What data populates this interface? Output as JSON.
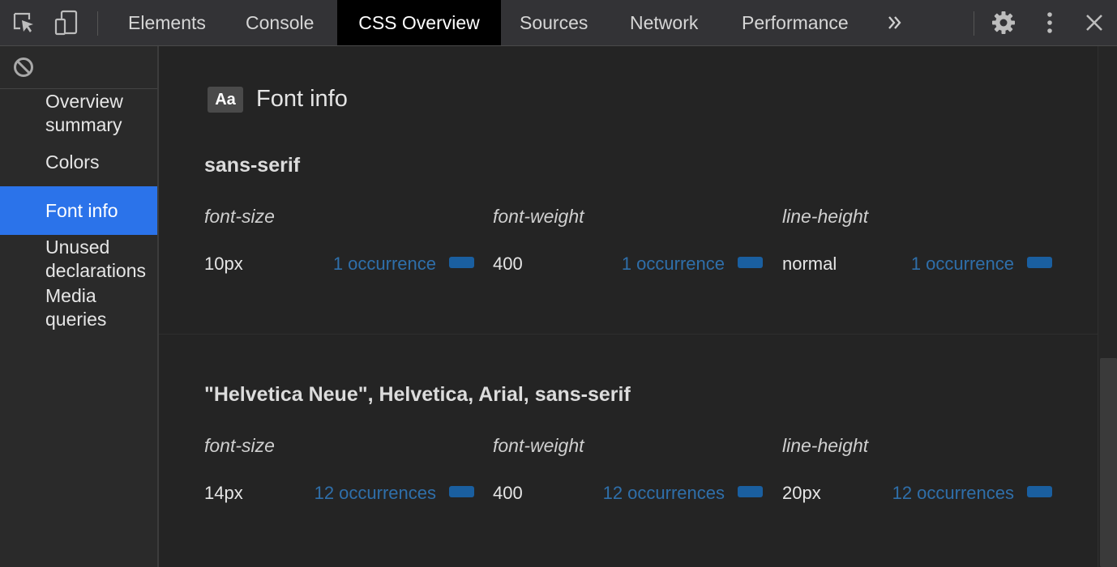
{
  "toolbar": {
    "tabs": [
      {
        "label": "Elements"
      },
      {
        "label": "Console"
      },
      {
        "label": "CSS Overview",
        "active": true
      },
      {
        "label": "Sources"
      },
      {
        "label": "Network"
      },
      {
        "label": "Performance"
      }
    ],
    "icons": [
      "inspect-element-icon",
      "device-toggle-icon",
      "more-tabs-icon",
      "settings-icon",
      "more-options-icon",
      "close-icon"
    ]
  },
  "sidebar": {
    "clear_icon": "clear-icon",
    "items": [
      {
        "label": "Overview summary"
      },
      {
        "label": "Colors"
      },
      {
        "label": "Font info",
        "selected": true
      },
      {
        "label": "Unused declarations"
      },
      {
        "label": "Media queries"
      }
    ]
  },
  "main": {
    "section_badge": "Aa",
    "section_title": "Font info",
    "font_groups": [
      {
        "family": "sans-serif",
        "columns": [
          {
            "property": "font-size",
            "value": "10px",
            "occurrences": "1 occurrence",
            "fraction": 1
          },
          {
            "property": "font-weight",
            "value": "400",
            "occurrences": "1 occurrence",
            "fraction": 1
          },
          {
            "property": "line-height",
            "value": "normal",
            "occurrences": "1 occurrence",
            "fraction": 1
          }
        ]
      },
      {
        "family": "\"Helvetica Neue\", Helvetica, Arial, sans-serif",
        "columns": [
          {
            "property": "font-size",
            "value": "14px",
            "occurrences": "12 occurrences",
            "fraction": 1
          },
          {
            "property": "font-weight",
            "value": "400",
            "occurrences": "12 occurrences",
            "fraction": 1
          },
          {
            "property": "line-height",
            "value": "20px",
            "occurrences": "12 occurrences",
            "fraction": 1
          }
        ]
      }
    ]
  },
  "colors": {
    "accent": "#2b73ea",
    "occurrence_text": "#2f6faa",
    "occurrence_bar": "#1a5fa0"
  }
}
